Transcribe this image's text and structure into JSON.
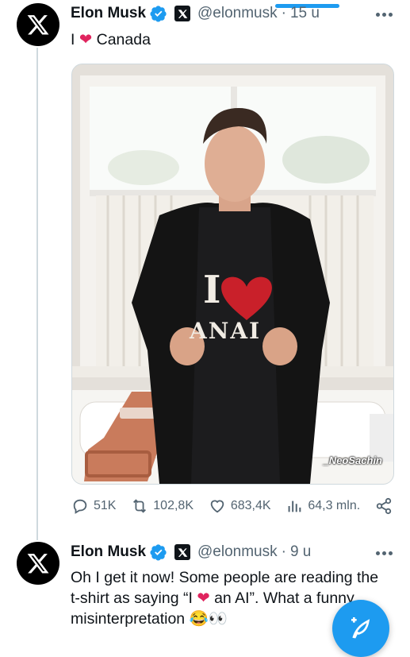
{
  "tweet1": {
    "author_name": "Elon Musk",
    "handle": "@elonmusk",
    "separator": "·",
    "time": "15 u",
    "text_before": "I",
    "text_after": "Canada",
    "heart_symbol": "❤",
    "watermark": "_NeoSachin",
    "shirt_text": "ANAI",
    "stats": {
      "replies": "51K",
      "reposts": "102,8K",
      "likes": "683,4K",
      "views": "64,3 mln."
    }
  },
  "tweet2": {
    "author_name": "Elon Musk",
    "handle": "@elonmusk",
    "separator": "·",
    "time": "9 u",
    "line1": "Oh I get it now! Some people are reading the",
    "line2_before": "t-shirt as saying “I",
    "heart_symbol": "❤",
    "line2_after": "an AI”. What a funny",
    "line3": "misinterpretation",
    "emoji": "😂👀"
  },
  "icons": {
    "avatar": "x-logo-icon",
    "verified": "verified-badge-icon",
    "affiliate": "x-affiliate-badge-icon",
    "more": "more-dots-icon",
    "reply": "reply-icon",
    "repost": "repost-icon",
    "like": "heart-icon",
    "views": "views-chart-icon",
    "share": "share-icon",
    "compose": "compose-feather-icon"
  },
  "colors": {
    "accent": "#1d9bf0",
    "heart": "#e0245e",
    "text": "#0f1419",
    "secondary": "#536471"
  }
}
